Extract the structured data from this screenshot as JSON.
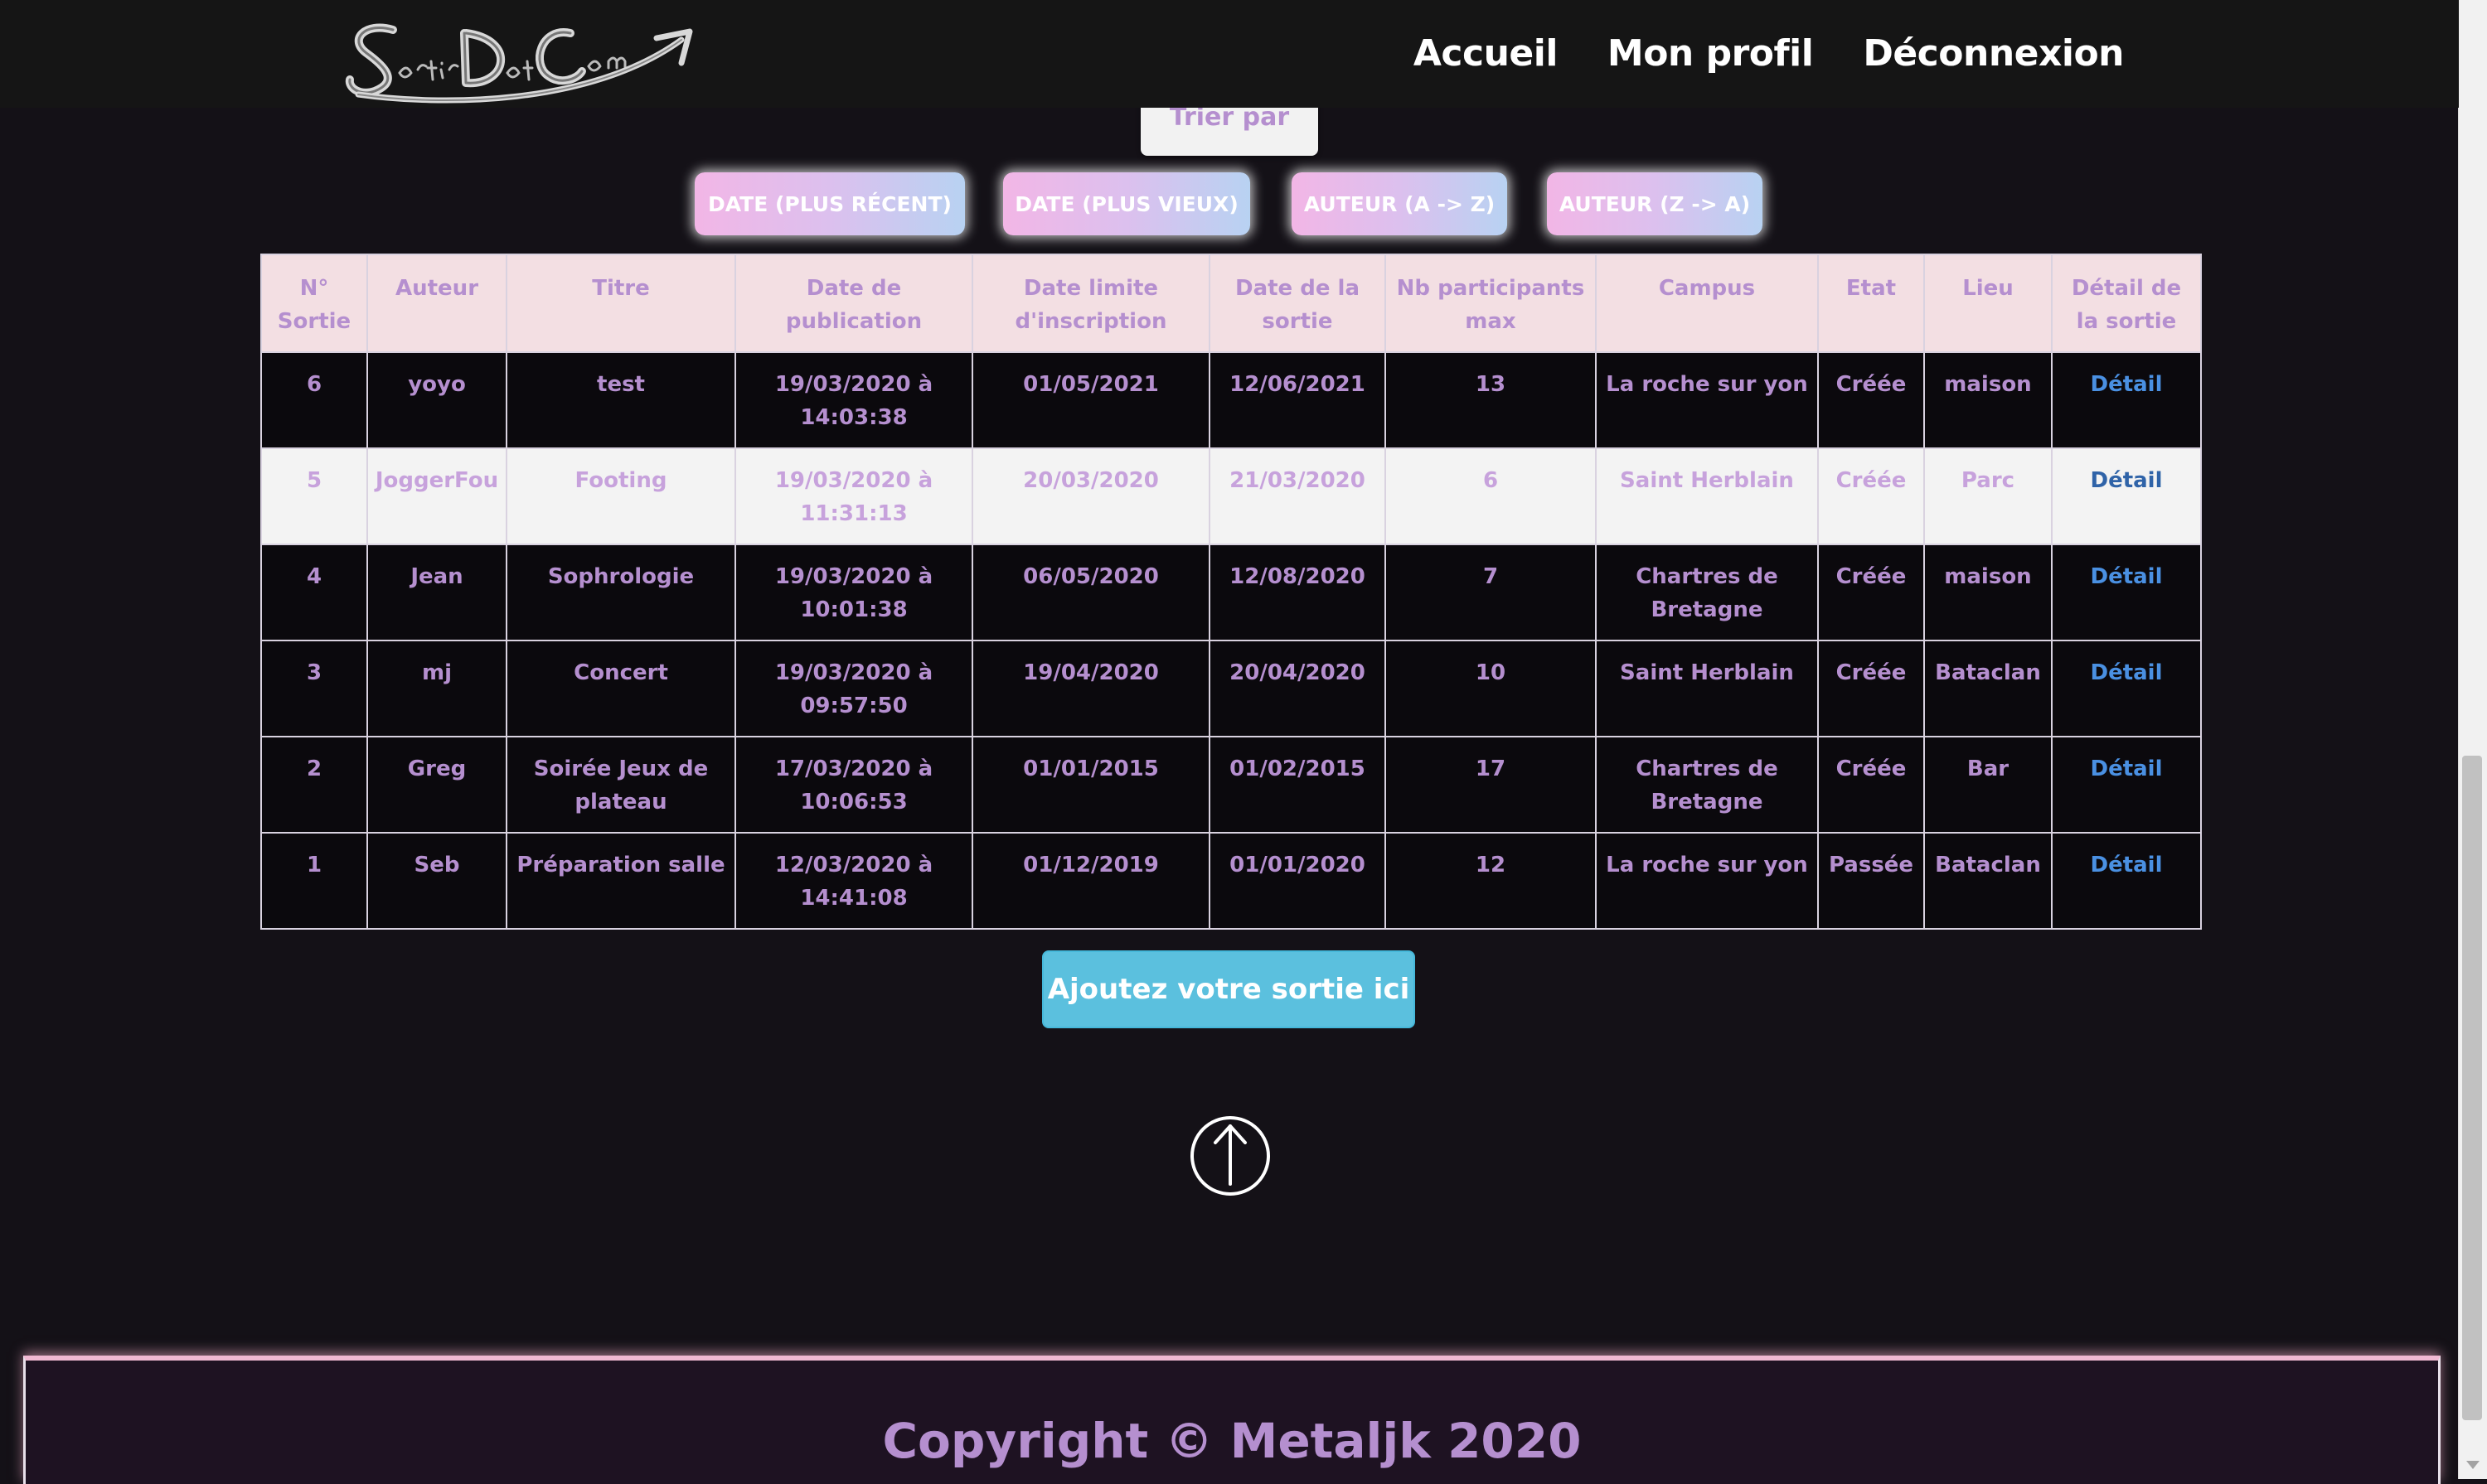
{
  "nav": {
    "logo_text": "SortirDotCom",
    "links": [
      "Accueil",
      "Mon profil",
      "Déconnexion"
    ]
  },
  "sort": {
    "header": "Trier par",
    "buttons": [
      "Date (plus récent)",
      "Date (plus vieux)",
      "Auteur (A -> Z)",
      "Auteur (Z -> A)"
    ]
  },
  "table": {
    "headers": [
      "N° Sortie",
      "Auteur",
      "Titre",
      "Date de publication",
      "Date limite d'inscription",
      "Date de la sortie",
      "Nb participants max",
      "Campus",
      "Etat",
      "Lieu",
      "Détail de la sortie"
    ],
    "rows": [
      [
        "6",
        "yoyo",
        "test",
        "19/03/2020 à 14:03:38",
        "01/05/2021",
        "12/06/2021",
        "13",
        "La roche sur yon",
        "Créée",
        "maison",
        "Détail"
      ],
      [
        "5",
        "JoggerFou",
        "Footing",
        "19/03/2020 à 11:31:13",
        "20/03/2020",
        "21/03/2020",
        "6",
        "Saint Herblain",
        "Créée",
        "Parc",
        "Détail"
      ],
      [
        "4",
        "Jean",
        "Sophrologie",
        "19/03/2020 à 10:01:38",
        "06/05/2020",
        "12/08/2020",
        "7",
        "Chartres de Bretagne",
        "Créée",
        "maison",
        "Détail"
      ],
      [
        "3",
        "mj",
        "Concert",
        "19/03/2020 à 09:57:50",
        "19/04/2020",
        "20/04/2020",
        "10",
        "Saint Herblain",
        "Créée",
        "Bataclan",
        "Détail"
      ],
      [
        "2",
        "Greg",
        "Soirée Jeux de plateau",
        "17/03/2020 à 10:06:53",
        "01/01/2015",
        "01/02/2015",
        "17",
        "Chartres de Bretagne",
        "Créée",
        "Bar",
        "Détail"
      ],
      [
        "1",
        "Seb",
        "Préparation salle",
        "12/03/2020 à 14:41:08",
        "01/12/2019",
        "01/01/2020",
        "12",
        "La roche sur yon",
        "Passée",
        "Bataclan",
        "Détail"
      ]
    ]
  },
  "add_button": "Ajoutez votre sortie ici",
  "footer": {
    "copyright": "Copyright © Metaljk 2020"
  },
  "colors": {
    "background": "#141117",
    "navbar": "#151515",
    "text_purple": "#b58fcf",
    "header_pink": "#f3dfe3",
    "link_blue": "#4a90e2",
    "add_button": "#5bc0de",
    "footer_bg": "#1e1222",
    "footer_border": "#f1b9d3"
  },
  "icons": {
    "logo": "sortirdotcom-logo",
    "scroll_top": "arrow-up-circle-icon"
  }
}
